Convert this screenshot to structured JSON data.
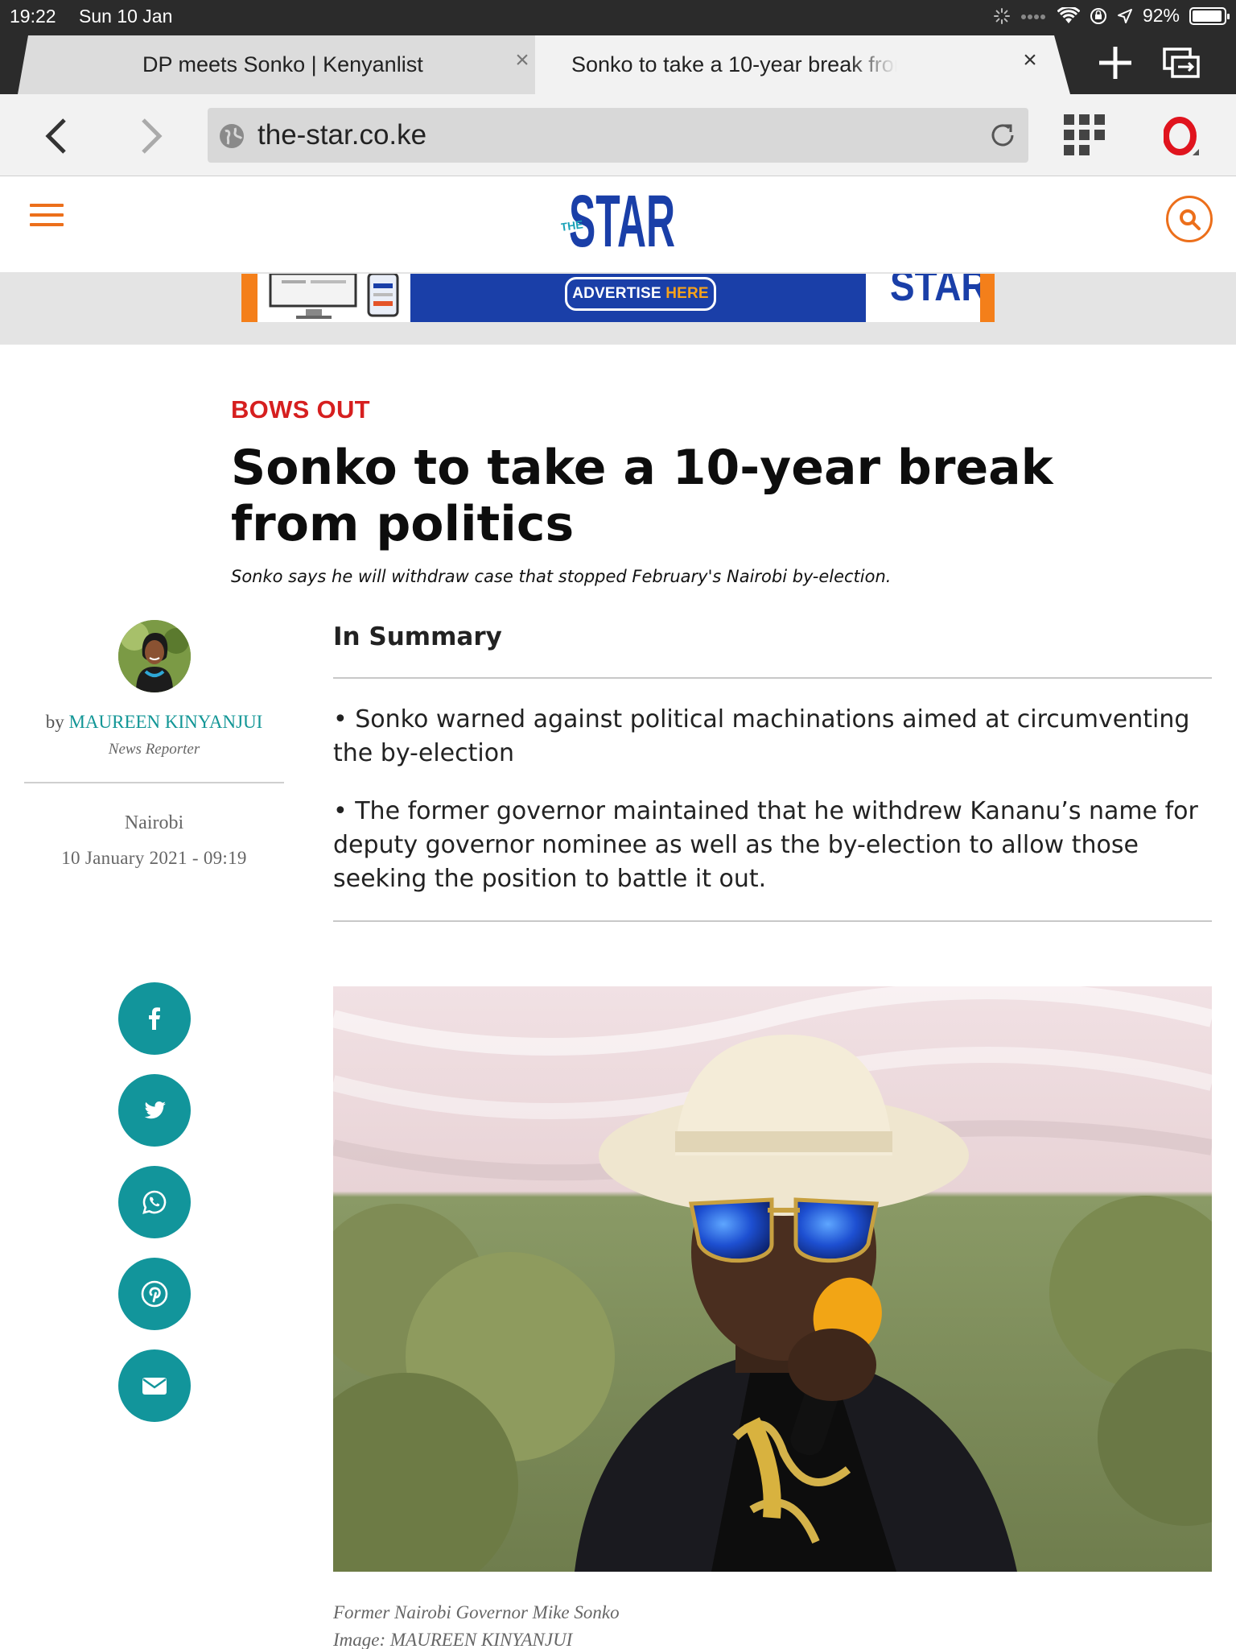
{
  "status_bar": {
    "time": "19:22",
    "date": "Sun 10 Jan",
    "battery": "92%"
  },
  "browser": {
    "tabs": [
      {
        "title": "DP meets Sonko | Kenyanlist",
        "active": false
      },
      {
        "title": "Sonko to take a 10-year break from politics",
        "active": true
      }
    ],
    "url": "the-star.co.ke"
  },
  "site": {
    "logo_main": "STAR",
    "logo_prefix": "THE",
    "brand_blue": "#1a3fa8",
    "accent_orange": "#ec6f1b"
  },
  "ad": {
    "pill_text": "ADVERTISE",
    "pill_highlight": "HERE",
    "fragment": "STAR"
  },
  "article": {
    "kicker": "BOWS OUT",
    "headline": "Sonko to take a 10-year break from politics",
    "subhead": "Sonko says he will withdraw case that stopped February's Nairobi by-election.",
    "author": {
      "by": "by",
      "name": "MAUREEN KINYANJUI",
      "role": "News Reporter",
      "location": "Nairobi",
      "datetime": "10 January 2021 - 09:19"
    },
    "summary": {
      "title": "In Summary",
      "bullets": [
        "• Sonko warned against political machinations aimed at circumventing the by-election",
        "• The former governor maintained that he withdrew Kananu’s name for deputy governor nominee as well as the by-election to allow those seeking the position to battle it out."
      ]
    },
    "share": [
      "facebook-icon",
      "twitter-icon",
      "whatsapp-icon",
      "pinterest-icon",
      "email-icon"
    ],
    "image": {
      "caption": "Former Nairobi Governor Mike Sonko",
      "credit": "Image: MAUREEN KINYANJUI"
    }
  }
}
